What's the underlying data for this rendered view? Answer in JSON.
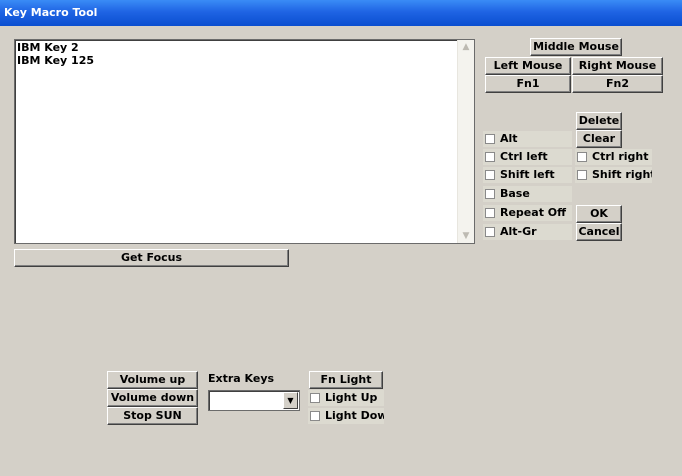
{
  "window": {
    "title": "Key Macro Tool"
  },
  "keylist": {
    "items": [
      "IBM Key 2",
      "IBM Key 125"
    ]
  },
  "buttons": {
    "middle_mouse": "Middle Mouse",
    "left_mouse": "Left Mouse",
    "right_mouse": "Right Mouse",
    "fn1": "Fn1",
    "fn2": "Fn2",
    "delete": "Delete",
    "clear": "Clear",
    "ok": "OK",
    "cancel": "Cancel",
    "get_focus": "Get Focus",
    "volume_up": "Volume up",
    "volume_down": "Volume down",
    "stop_sun": "Stop SUN",
    "fn_light": "Fn Light"
  },
  "modifiers": {
    "alt": "Alt",
    "ctrl_left": "Ctrl left",
    "shift_left": "Shift left",
    "base": "Base",
    "repeat_off": "Repeat Off",
    "alt_gr": "Alt-Gr",
    "ctrl_right": "Ctrl right",
    "shift_right": "Shift right"
  },
  "extra_keys": {
    "label": "Extra Keys",
    "selected": ""
  },
  "light": {
    "up": "Light Up",
    "down": "Light Dow"
  }
}
